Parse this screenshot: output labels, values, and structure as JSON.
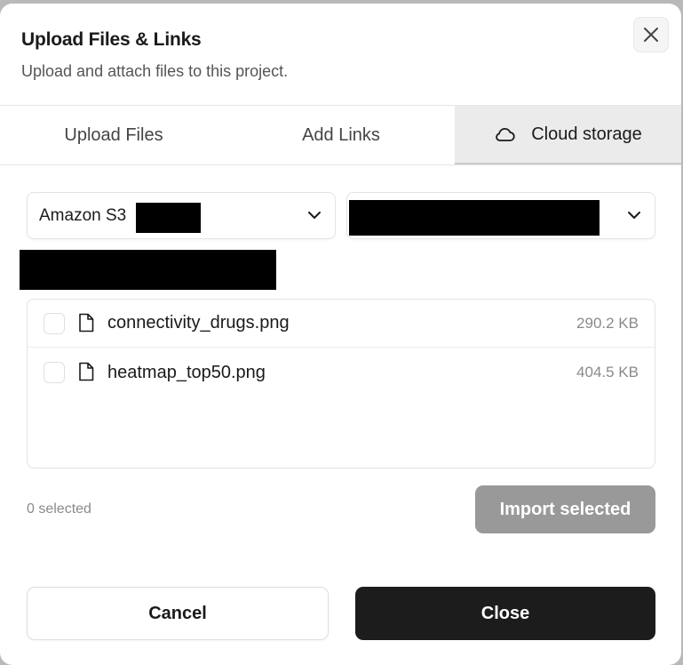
{
  "dialog": {
    "title": "Upload Files & Links",
    "subtitle": "Upload and attach files to this project."
  },
  "tabs": [
    {
      "label": "Upload Files",
      "active": false
    },
    {
      "label": "Add Links",
      "active": false
    },
    {
      "label": "Cloud storage",
      "active": true,
      "icon": "cloud-icon"
    }
  ],
  "provider_select": {
    "value": "Amazon S3",
    "redacted_suffix": true
  },
  "bucket_select": {
    "value_redacted": true
  },
  "files": [
    {
      "name": "connectivity_drugs.png",
      "size": "290.2 KB",
      "checked": false,
      "icon": "file-icon"
    },
    {
      "name": "heatmap_top50.png",
      "size": "404.5 KB",
      "checked": false,
      "icon": "file-icon"
    }
  ],
  "footer": {
    "selected_count": "0 selected",
    "import_label": "Import selected",
    "cancel_label": "Cancel",
    "close_label": "Close"
  },
  "colors": {
    "primary_button": "#1c1c1c",
    "disabled_button": "#999999",
    "active_tab": "#ebebeb"
  }
}
